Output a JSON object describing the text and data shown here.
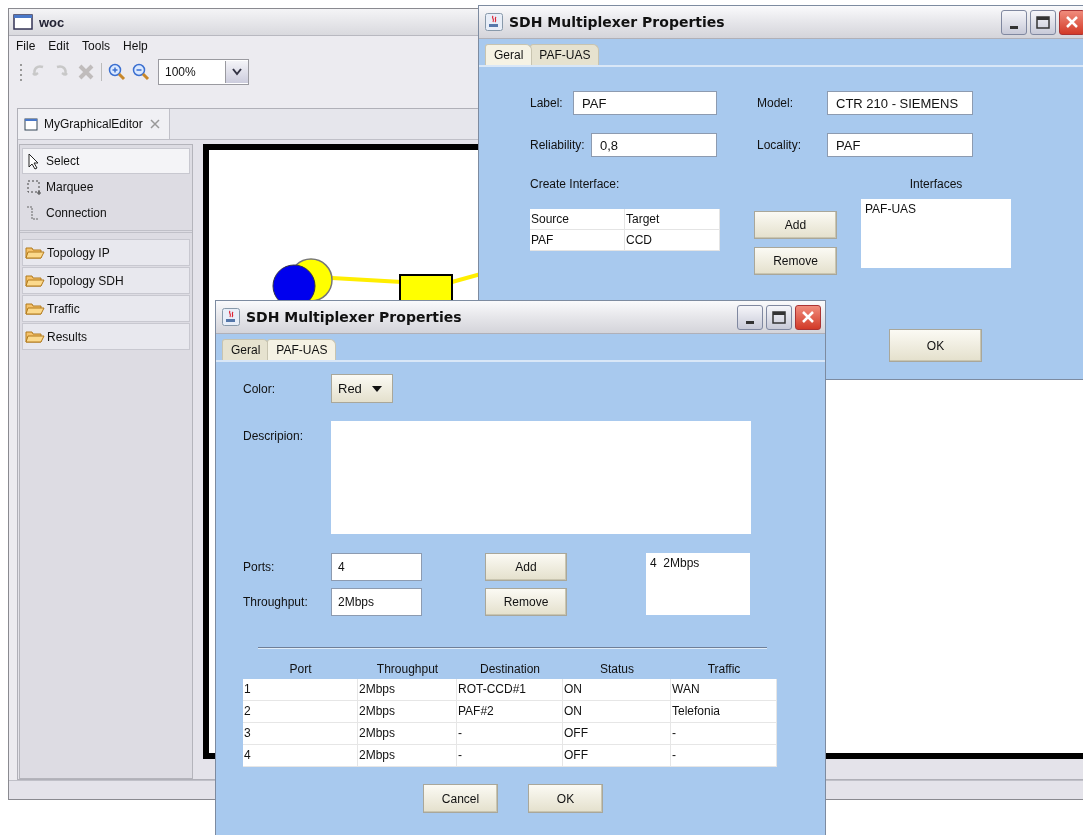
{
  "main_window": {
    "title": "woc",
    "menu": [
      "File",
      "Edit",
      "Tools",
      "Help"
    ],
    "toolbar": [
      {
        "kind": "undo",
        "disabled": true
      },
      {
        "kind": "redo",
        "disabled": true
      },
      {
        "kind": "delete",
        "disabled": true
      },
      {
        "kind": "zoom_in",
        "disabled": false
      },
      {
        "kind": "zoom_out",
        "disabled": false
      }
    ],
    "zoom": "100%",
    "editor_tab": "MyGraphicalEditor",
    "palette": {
      "tools": [
        {
          "label": "Select",
          "kind": "pointer",
          "selected": true
        },
        {
          "label": "Marquee",
          "kind": "marquee",
          "selected": false
        },
        {
          "label": "Connection",
          "kind": "connection",
          "selected": false
        }
      ],
      "drawers": [
        "Topology IP",
        "Topology SDH",
        "Traffic",
        "Results"
      ]
    }
  },
  "dialogs": [
    {
      "kind": "geral",
      "title": "SDH Multiplexer Properties",
      "tabs": [
        {
          "label": "Geral",
          "selected": true
        },
        {
          "label": "PAF-UAS",
          "selected": false
        }
      ],
      "label": {
        "caption": "Label:",
        "value": "PAF"
      },
      "model": {
        "caption": "Model:",
        "value": "CTR 210 - SIEMENS"
      },
      "reliability": {
        "caption": "Reliability:",
        "value": "0,8"
      },
      "locality": {
        "caption": "Locality:",
        "value": "PAF"
      },
      "create_interface": {
        "caption": "Create Interface:",
        "columns": [
          "Source",
          "Target"
        ],
        "rows": [
          [
            "PAF",
            "CCD"
          ]
        ]
      },
      "buttons": [
        "Add",
        "Remove"
      ],
      "interfaces": {
        "caption": "Interfaces",
        "items": [
          "PAF-UAS"
        ]
      },
      "ok": "OK"
    },
    {
      "kind": "ports",
      "title": "SDH Multiplexer Properties",
      "tabs": [
        {
          "label": "Geral",
          "selected": false
        },
        {
          "label": "PAF-UAS",
          "selected": true
        }
      ],
      "color": {
        "caption": "Color:",
        "value": "Red"
      },
      "description": {
        "caption": "Descripion:"
      },
      "ports": {
        "caption": "Ports:",
        "value": "4"
      },
      "throughput": {
        "caption": "Throughput:",
        "value": "2Mbps"
      },
      "buttons": [
        "Add",
        "Remove"
      ],
      "port_list": [
        "4  2Mbps"
      ],
      "table": {
        "columns": [
          "Port",
          "Throughput",
          "Destination",
          "Status",
          "Traffic"
        ],
        "rows": [
          [
            "1",
            "2Mbps",
            "ROT-CCD#1",
            "ON",
            "WAN"
          ],
          [
            "2",
            "2Mbps",
            "PAF#2",
            "ON",
            "Telefonia"
          ],
          [
            "3",
            "2Mbps",
            "-",
            "OFF",
            "-"
          ],
          [
            "4",
            "2Mbps",
            "-",
            "OFF",
            "-"
          ]
        ]
      },
      "footer": [
        "Cancel",
        "OK"
      ]
    }
  ]
}
